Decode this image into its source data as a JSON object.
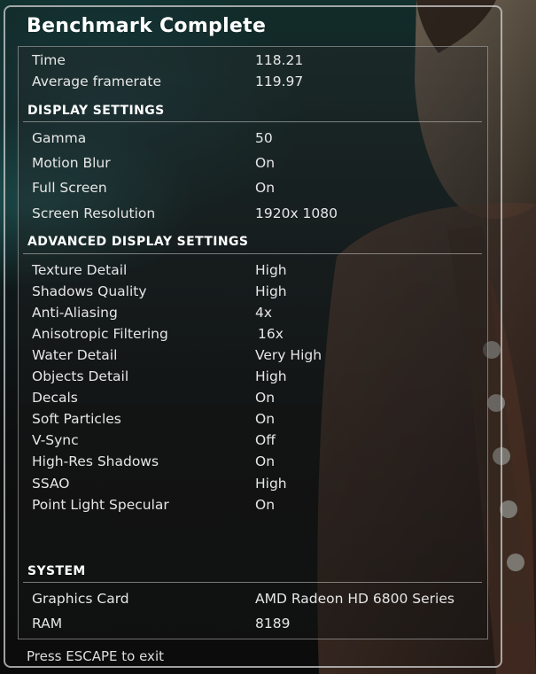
{
  "title": "Benchmark Complete",
  "results": [
    {
      "label": "Time",
      "value": "118.21"
    },
    {
      "label": "Average framerate",
      "value": "119.97"
    }
  ],
  "display_settings": {
    "heading": "DISPLAY SETTINGS",
    "items": [
      {
        "label": "Gamma",
        "value": "50"
      },
      {
        "label": "Motion Blur",
        "value": "On"
      },
      {
        "label": "Full Screen",
        "value": "On"
      },
      {
        "label": "Screen Resolution",
        "value": "1920x 1080"
      }
    ]
  },
  "advanced_display_settings": {
    "heading": "ADVANCED DISPLAY SETTINGS",
    "items": [
      {
        "label": "Texture Detail",
        "value": "High"
      },
      {
        "label": "Shadows Quality",
        "value": "High"
      },
      {
        "label": "Anti-Aliasing",
        "value": "4x"
      },
      {
        "label": "Anisotropic Filtering",
        "value": "16x"
      },
      {
        "label": "Water Detail",
        "value": "Very High"
      },
      {
        "label": "Objects Detail",
        "value": "High"
      },
      {
        "label": "Decals",
        "value": "On"
      },
      {
        "label": "Soft Particles",
        "value": "On"
      },
      {
        "label": "V-Sync",
        "value": "Off"
      },
      {
        "label": "High-Res Shadows",
        "value": "On"
      },
      {
        "label": "SSAO",
        "value": "High"
      },
      {
        "label": "Point Light Specular",
        "value": "On"
      }
    ]
  },
  "system": {
    "heading": "SYSTEM",
    "items": [
      {
        "label": "Graphics Card",
        "value": "AMD Radeon HD 6800 Series"
      },
      {
        "label": "RAM",
        "value": "8189"
      }
    ]
  },
  "footer": "Press ESCAPE to exit"
}
